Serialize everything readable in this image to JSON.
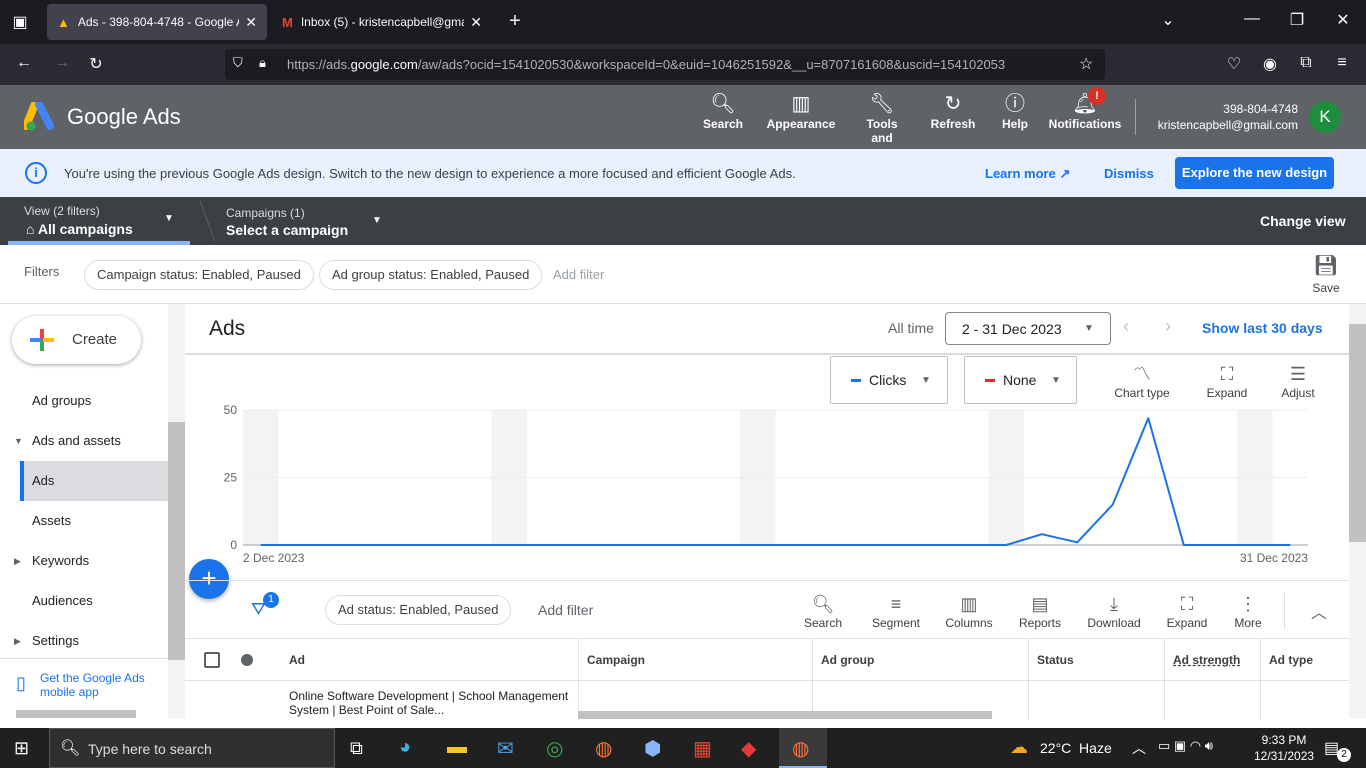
{
  "browser": {
    "tabs": [
      {
        "label": "Ads - 398-804-4748 - Google Ads",
        "active": true
      },
      {
        "label": "Inbox (5) - kristencapbell@gmail.com",
        "active": false
      }
    ],
    "url_prefix": "https://ads.",
    "url_domain": "google.com",
    "url_rest": "/aw/ads?ocid=1541020530&workspaceId=0&euid=1046251592&__u=8707161608&uscid=154102053"
  },
  "header": {
    "logo_text": "Google Ads",
    "buttons": [
      {
        "label": "Search",
        "icon": "search-icon"
      },
      {
        "label": "Appearance",
        "icon": "appearance-icon"
      },
      {
        "label": "Tools and",
        "icon": "wrench-icon"
      },
      {
        "label": "Refresh",
        "icon": "refresh-icon"
      },
      {
        "label": "Help",
        "icon": "help-icon"
      },
      {
        "label": "Notifications",
        "icon": "bell-icon"
      }
    ],
    "notification_badge": "!",
    "account_id": "398-804-4748",
    "account_email": "kristencapbell@gmail.com",
    "avatar_letter": "K"
  },
  "banner": {
    "message": "You're using the previous Google Ads design. Switch to the new design to experience a more focused and efficient Google Ads.",
    "learn_more": "Learn more",
    "dismiss": "Dismiss",
    "explore": "Explore the new design"
  },
  "viewbar": {
    "view_label": "View (2 filters)",
    "view_value": "All campaigns",
    "campaigns_label": "Campaigns (1)",
    "campaigns_value": "Select a campaign",
    "change_view": "Change view"
  },
  "filters": {
    "label": "Filters",
    "chips": [
      "Campaign status: Enabled, Paused",
      "Ad group status: Enabled, Paused"
    ],
    "add_filter": "Add filter",
    "save": "Save"
  },
  "sidebar": {
    "create": "Create",
    "items": [
      {
        "label": "Ad groups"
      },
      {
        "label": "Ads and assets"
      },
      {
        "label": "Ads"
      },
      {
        "label": "Assets"
      },
      {
        "label": "Keywords"
      },
      {
        "label": "Audiences"
      },
      {
        "label": "Settings"
      }
    ],
    "mobile_app": "Get the Google Ads mobile app"
  },
  "main": {
    "title": "Ads",
    "range_label": "All time",
    "date_range": "2 - 31 Dec 2023",
    "show_last": "Show last 30 days",
    "metric1": "Clicks",
    "metric2": "None",
    "chart_type": "Chart type",
    "expand": "Expand",
    "adjust": "Adjust"
  },
  "chart_data": {
    "type": "line",
    "x_start_label": "2 Dec 2023",
    "x_end_label": "31 Dec 2023",
    "y_ticks": [
      "50",
      "25",
      "0"
    ],
    "ylim": [
      0,
      50
    ],
    "x": [
      "2 Dec",
      "3 Dec",
      "4 Dec",
      "5 Dec",
      "6 Dec",
      "7 Dec",
      "8 Dec",
      "9 Dec",
      "10 Dec",
      "11 Dec",
      "12 Dec",
      "13 Dec",
      "14 Dec",
      "15 Dec",
      "16 Dec",
      "17 Dec",
      "18 Dec",
      "19 Dec",
      "20 Dec",
      "21 Dec",
      "22 Dec",
      "23 Dec",
      "24 Dec",
      "25 Dec",
      "26 Dec",
      "27 Dec",
      "28 Dec",
      "29 Dec",
      "30 Dec",
      "31 Dec"
    ],
    "series": [
      {
        "values": [
          0,
          0,
          0,
          0,
          0,
          0,
          0,
          0,
          0,
          0,
          0,
          0,
          0,
          0,
          0,
          0,
          0,
          0,
          0,
          0,
          0,
          0,
          4,
          1,
          15,
          47,
          0,
          0,
          0,
          0
        ],
        "color": "#1a73e8"
      }
    ]
  },
  "table_toolbar": {
    "filter_count": "1",
    "status_chip": "Ad status: Enabled, Paused",
    "add_filter": "Add filter",
    "buttons": [
      "Search",
      "Segment",
      "Columns",
      "Reports",
      "Download",
      "Expand",
      "More"
    ]
  },
  "table": {
    "headers": [
      "Ad",
      "Campaign",
      "Ad group",
      "Status",
      "Ad strength",
      "Ad type"
    ],
    "rows": [
      {
        "ad": "Online Software Development | School Management System | Best Point of Sale..."
      }
    ]
  },
  "taskbar": {
    "search_placeholder": "Type here to search",
    "weather": "22°C  Haze",
    "time": "9:33 PM",
    "date": "12/31/2023",
    "notif_count": "2"
  }
}
